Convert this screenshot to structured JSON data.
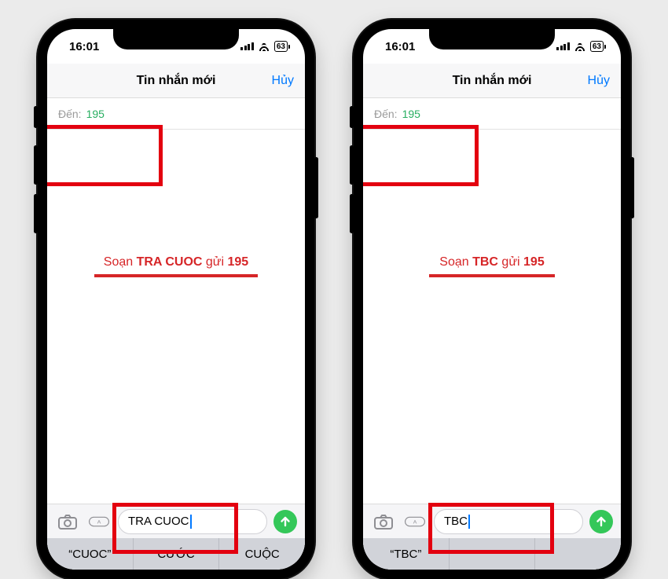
{
  "phones": [
    {
      "status": {
        "time": "16:01",
        "battery": "63"
      },
      "nav": {
        "title": "Tin nhắn mới",
        "cancel": "Hủy"
      },
      "recipient": {
        "label": "Đến:",
        "value": "195"
      },
      "annotation": {
        "prefix": "Soạn ",
        "cmd": "TRA CUOC",
        "middle": " gửi ",
        "num": "195",
        "underline_width": 208
      },
      "compose": {
        "text": "TRA CUOC"
      },
      "suggestions": [
        "“CUOC”",
        "CƯỚC",
        "CUỘC"
      ]
    },
    {
      "status": {
        "time": "16:01",
        "battery": "63"
      },
      "nav": {
        "title": "Tin nhắn mới",
        "cancel": "Hủy"
      },
      "recipient": {
        "label": "Đến:",
        "value": "195"
      },
      "annotation": {
        "prefix": "Soạn ",
        "cmd": "TBC",
        "middle": " gửi ",
        "num": "195",
        "underline_width": 160
      },
      "compose": {
        "text": "TBC"
      },
      "suggestions": [
        "“TBC”",
        "",
        ""
      ]
    }
  ]
}
